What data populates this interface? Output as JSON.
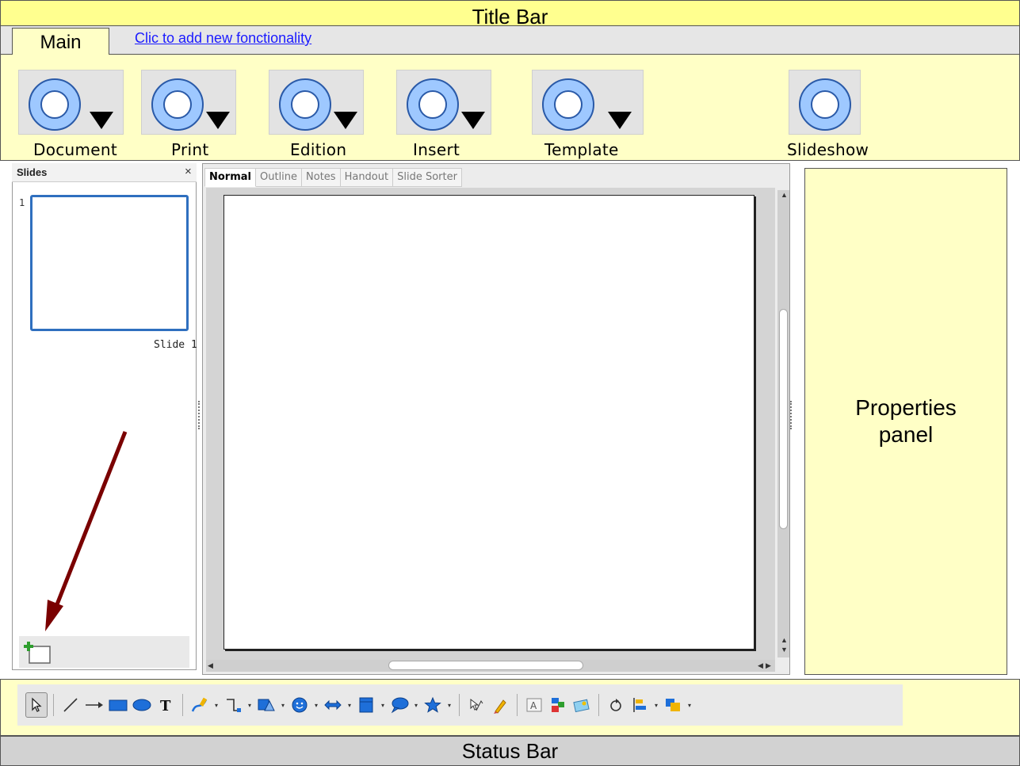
{
  "title_bar": {
    "label": "Title Bar"
  },
  "tabs": {
    "main_label": "Main",
    "add_link": "Clic to add new fonctionality"
  },
  "ribbon": {
    "buttons": [
      {
        "label": "Document",
        "icon": "ring-dropdown-icon"
      },
      {
        "label": "Print",
        "icon": "ring-dropdown-icon"
      },
      {
        "label": "Edition",
        "icon": "ring-dropdown-icon"
      },
      {
        "label": "Insert",
        "icon": "ring-dropdown-icon"
      },
      {
        "label": "Template",
        "icon": "ring-dropdown-icon"
      },
      {
        "label": "Slideshow",
        "icon": "ring-icon"
      }
    ],
    "colors": {
      "ring_fill": "#9ec8ff",
      "ring_stroke": "#2a5aa8"
    }
  },
  "slides_panel": {
    "title": "Slides",
    "close": "×",
    "slide_number": "1",
    "slide_name": "Slide 1"
  },
  "view_tabs": [
    "Normal",
    "Outline",
    "Notes",
    "Handout",
    "Slide Sorter"
  ],
  "properties": {
    "line1": "Properties",
    "line2": "panel"
  },
  "status_bar": {
    "label": "Status Bar"
  },
  "annotation": {
    "arrow_color": "#7a0000"
  },
  "toolbar_tools": [
    "select-pointer",
    "line",
    "arrow-line",
    "rectangle",
    "ellipse",
    "text",
    "curve",
    "connector",
    "basic-shapes",
    "symbol-shapes",
    "block-arrows",
    "flowchart",
    "callouts",
    "stars",
    "points",
    "glue-points",
    "fontwork",
    "from-file",
    "gallery",
    "rotate",
    "align",
    "arrange"
  ],
  "colors": {
    "title_bar": "#ffff8f",
    "panel_yellow": "#ffffc6",
    "status_bar": "#d2d2d2",
    "thumb_border": "#2f6fbf"
  }
}
